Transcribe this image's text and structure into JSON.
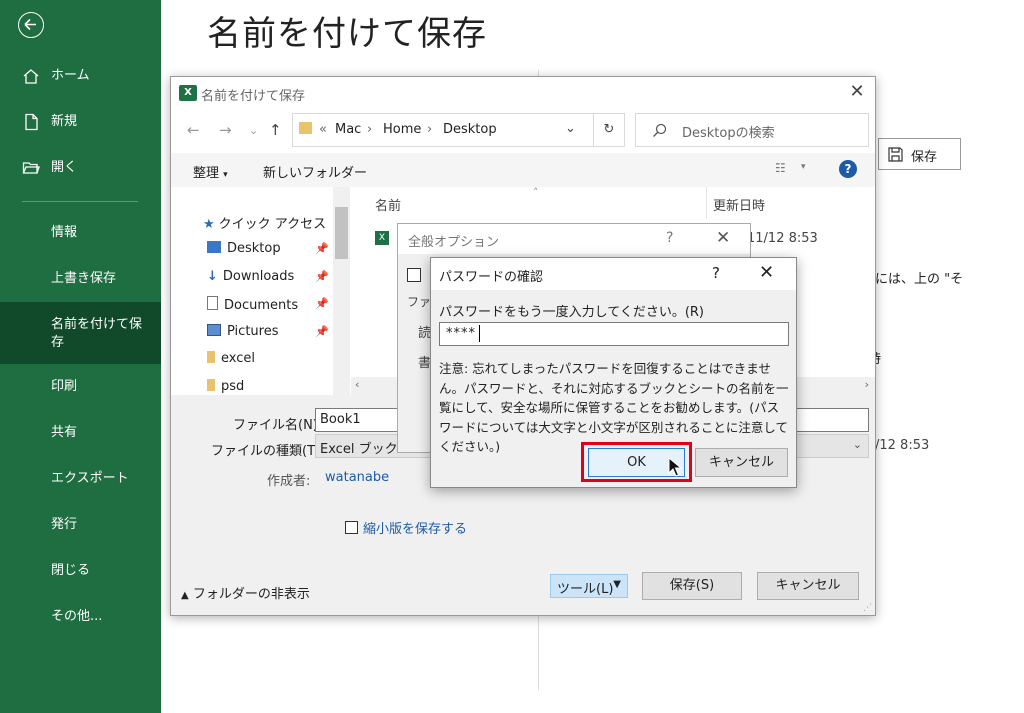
{
  "page_title": "名前を付けて保存",
  "sidebar": {
    "items": [
      {
        "label": "ホーム",
        "icon": "home-icon"
      },
      {
        "label": "新規",
        "icon": "new-document-icon"
      },
      {
        "label": "開く",
        "icon": "open-folder-icon"
      },
      {
        "label": "情報"
      },
      {
        "label": "上書き保存"
      },
      {
        "label": "名前を付けて保存"
      },
      {
        "label": "印刷"
      },
      {
        "label": "共有"
      },
      {
        "label": "エクスポート"
      },
      {
        "label": "発行"
      },
      {
        "label": "閉じる"
      },
      {
        "label": "その他..."
      }
    ],
    "active_index": 5
  },
  "background": {
    "save_button": "保存",
    "text1": "には、上の \"そ",
    "text2": "/12 8:53",
    "text3": "時"
  },
  "save_dialog": {
    "title": "名前を付けて保存",
    "breadcrumb": {
      "prefix": "«",
      "items": [
        "Mac",
        "Home",
        "Desktop"
      ]
    },
    "search_placeholder": "Desktopの検索",
    "organize_label": "整理",
    "new_folder_label": "新しいフォルダー",
    "nav_items": [
      {
        "label": "クイック アクセス",
        "icon": "star-icon"
      },
      {
        "label": "Desktop",
        "icon": "desktop-icon",
        "pinned": true
      },
      {
        "label": "Downloads",
        "icon": "download-icon",
        "pinned": true
      },
      {
        "label": "Documents",
        "icon": "documents-icon",
        "pinned": true
      },
      {
        "label": "Pictures",
        "icon": "pictures-icon",
        "pinned": true
      },
      {
        "label": "excel",
        "icon": "folder-icon"
      },
      {
        "label": "psd",
        "icon": "folder-icon"
      }
    ],
    "columns": {
      "name": "名前",
      "modified": "更新日時"
    },
    "file_row_date": "11/12 8:53",
    "file_name_label": "ファイル名(N):",
    "file_name_value": "Book1",
    "file_type_label": "ファイルの種類(T):",
    "file_type_value": "Excel ブック",
    "author_label": "作成者:",
    "author_value": "watanabe",
    "thumbnail_label": "縮小版を保存する",
    "hide_folders_label": "フォルダーの非表示",
    "tools_label": "ツール(L)",
    "save_label": "保存(S)",
    "cancel_label": "キャンセル"
  },
  "general_options": {
    "title": "全般オプション",
    "help": "?",
    "frag_file": "ファイ",
    "frag_read": "読",
    "frag_write": "書"
  },
  "password_dialog": {
    "title": "パスワードの確認",
    "help": "?",
    "prompt": "パスワードをもう一度入力してください。(R)",
    "value": "****",
    "note": "注意: 忘れてしまったパスワードを回復することはできません。パスワードと、それに対応するブックとシートの名前を一覧にして、安全な場所に保管することをお勧めします。(パスワードについては大文字と小文字が区別されることに注意してください。)",
    "ok_label": "OK",
    "cancel_label": "キャンセル"
  },
  "colors": {
    "sidebar": "#1e6e41",
    "sidebar_active": "#114a2a",
    "highlight": "#e0001b",
    "link": "#1e5aa8"
  }
}
